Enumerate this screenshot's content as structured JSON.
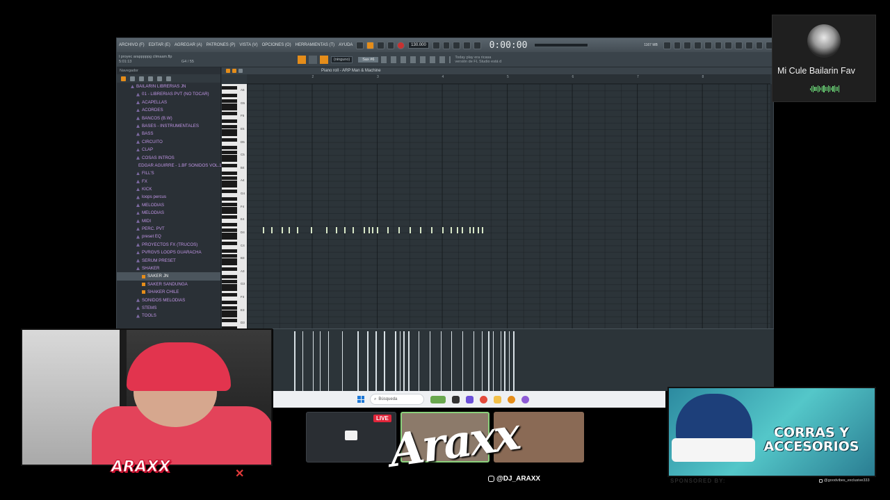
{
  "fl": {
    "menus": [
      "ARCHIVO (F)",
      "EDITAR (E)",
      "AGREGAR (A)",
      "PATRONES (P)",
      "VISTA (V)",
      "OPCIONES (O)",
      "HERRAMIENTAS (T)",
      "AYUDA"
    ],
    "tempo": "130.000",
    "time": "0:00:00",
    "project_file": "l proyec arapppppg climaam.flp",
    "project_time": "5:01:13",
    "project_pos": "G4 / 55",
    "pattern": "(ninguno)",
    "preset": "Sax #6",
    "hint": "Today play era ricasa versión de FL Studio está d",
    "cpu": "1167 MB",
    "piano_roll_title": "Piano roll - ARP Man & Machine",
    "accent": "#e58d1a",
    "note_color": "#d9e8c8"
  },
  "browser": {
    "header": "Navegador",
    "items": [
      {
        "label": "BAILARIN LIBRERIAS JN",
        "type": "folder"
      },
      {
        "label": "01 - LIBRERIAS PVT (NO TOCAR)",
        "type": "folder"
      },
      {
        "label": "ACAPELLAS",
        "type": "folder"
      },
      {
        "label": "ACORDES",
        "type": "folder"
      },
      {
        "label": "BANCOS (B.W)",
        "type": "folder"
      },
      {
        "label": "BASES - INSTRUMENTALES",
        "type": "folder"
      },
      {
        "label": "BASS",
        "type": "folder"
      },
      {
        "label": "CIRCUITO",
        "type": "folder"
      },
      {
        "label": "CLAP",
        "type": "folder"
      },
      {
        "label": "COSAS INTROS",
        "type": "folder"
      },
      {
        "label": "EDGAR AGUIRRE - 1.BF SONIDOS VOL.1",
        "type": "folder"
      },
      {
        "label": "FILL'S",
        "type": "folder"
      },
      {
        "label": "FX",
        "type": "folder"
      },
      {
        "label": "KICK",
        "type": "folder"
      },
      {
        "label": "loops percus",
        "type": "folder"
      },
      {
        "label": "MELODIAS",
        "type": "folder"
      },
      {
        "label": "MELODIAS",
        "type": "folder"
      },
      {
        "label": "MIDI",
        "type": "folder"
      },
      {
        "label": "PERC. PVT",
        "type": "folder"
      },
      {
        "label": "preset EQ",
        "type": "folder"
      },
      {
        "label": "PROYECTOS FX (TRUCOS)",
        "type": "folder"
      },
      {
        "label": "PVRGVS LOOPS GUARACHA",
        "type": "folder"
      },
      {
        "label": "SERUM PRESET",
        "type": "folder"
      },
      {
        "label": "SHAKER",
        "type": "folder"
      },
      {
        "label": "SAKER JN",
        "type": "file",
        "selected": true
      },
      {
        "label": "SAKER SANDUNGA",
        "type": "file"
      },
      {
        "label": "SHAKER CHILE",
        "type": "file"
      },
      {
        "label": "SONIDOS MELODIAS",
        "type": "folder"
      },
      {
        "label": "STEMS",
        "type": "folder"
      },
      {
        "label": "TOOLS",
        "type": "folder"
      }
    ]
  },
  "ruler": [
    "2",
    "3",
    "4",
    "5",
    "6",
    "7",
    "8"
  ],
  "keys": [
    "A5",
    "G5",
    "F5",
    "E5",
    "D5",
    "C5",
    "B4",
    "A4",
    "G4",
    "F4",
    "E4",
    "D4",
    "C4",
    "B3",
    "A3",
    "G3",
    "F3",
    "E3",
    "D3"
  ],
  "notes": [
    0.25,
    0.37,
    0.53,
    0.64,
    0.77,
    0.98,
    1.22,
    1.37,
    1.5,
    1.63,
    1.8,
    1.87,
    1.93,
    2.0,
    2.16,
    2.33,
    2.5,
    2.66,
    2.83,
    3.0,
    3.13,
    3.23,
    3.3,
    3.42,
    3.48,
    3.55,
    3.62
  ],
  "taskbar": {
    "search": "Búsqueda"
  },
  "card": {
    "title": "Mi Cule Bailarin Fav"
  },
  "stream": {
    "live": "LIVE",
    "signature": "Araxx",
    "instagram": "@DJ_ARAXX",
    "cam_logo": "ARAXX"
  },
  "ad": {
    "text": "CORRAS Y ACCESORIOS",
    "sponsored": "SPONSORED BY:",
    "handle": "@goodvibes_exclusive333"
  }
}
